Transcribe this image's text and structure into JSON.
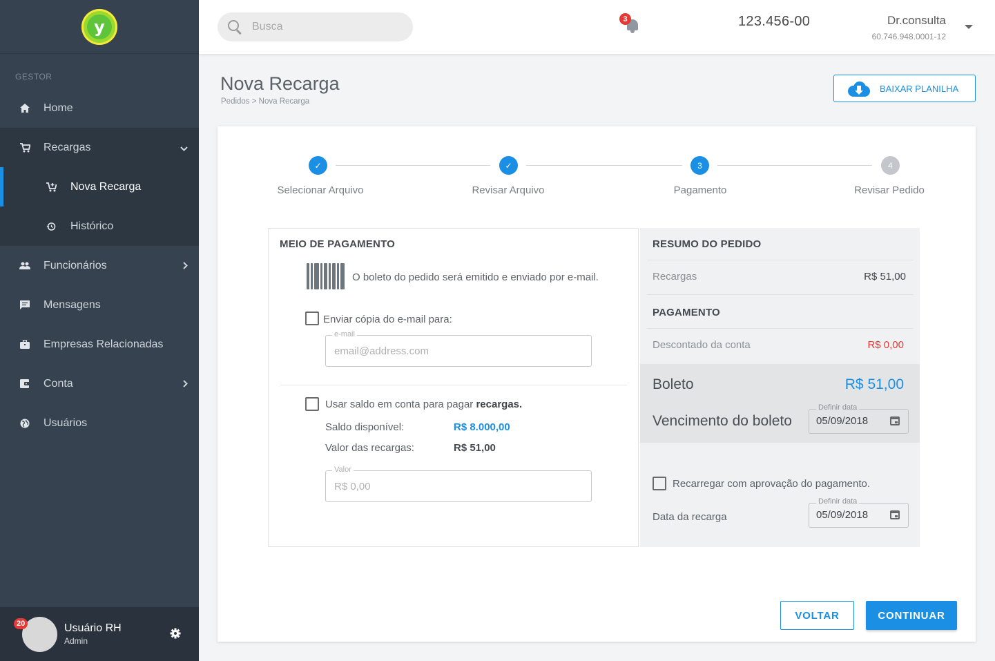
{
  "sidebar": {
    "logo_letter": "y",
    "section_label": "GESTOR",
    "items": [
      {
        "label": "Home",
        "icon": "home-icon"
      },
      {
        "label": "Recargas",
        "icon": "cart-icon"
      },
      {
        "label": "Nova Recarga",
        "icon": "cart-add-icon"
      },
      {
        "label": "Histórico",
        "icon": "history-icon"
      },
      {
        "label": "Funcionários",
        "icon": "people-icon"
      },
      {
        "label": "Mensagens",
        "icon": "message-icon"
      },
      {
        "label": "Empresas Relacionadas",
        "icon": "briefcase-icon"
      },
      {
        "label": "Conta",
        "icon": "wallet-icon"
      },
      {
        "label": "Usuários",
        "icon": "globe-icon"
      }
    ],
    "user": {
      "name": "Usuário RH",
      "role": "Admin",
      "badge": "20"
    }
  },
  "topbar": {
    "search_placeholder": "Busca",
    "notification_count": "3",
    "account_number": "123.456-00",
    "company_name": "Dr.consulta",
    "company_cnpj": "60.746.948.0001-12"
  },
  "page": {
    "title": "Nova Recarga",
    "breadcrumb": "Pedidos > Nova Recarga",
    "download_button": "BAIXAR PLANILHA"
  },
  "stepper": {
    "steps": [
      {
        "label": "Selecionar Arquivo",
        "marker": "✓",
        "state": "done"
      },
      {
        "label": "Revisar Arquivo",
        "marker": "✓",
        "state": "done"
      },
      {
        "label": "Pagamento",
        "marker": "3",
        "state": "current"
      },
      {
        "label": "Revisar Pedido",
        "marker": "4",
        "state": "todo"
      }
    ]
  },
  "payment": {
    "title": "MEIO DE PAGAMENTO",
    "boleto_info": "O boleto do pedido será emitido e enviado por e-mail.",
    "email_copy_label": "Enviar cópia do e-mail para:",
    "email_field_label": "e-mail",
    "email_placeholder": "email@address.com",
    "use_balance_label": "Usar saldo em conta para pagar ",
    "use_balance_bold": "recargas.",
    "available_balance_label": "Saldo disponível:",
    "available_balance_value": "R$ 8.000,00",
    "recharge_value_label": "Valor das recargas:",
    "recharge_value_value": "R$ 51,00",
    "value_field_label": "Valor",
    "value_placeholder": "R$ 0,00"
  },
  "summary": {
    "title": "RESUMO DO PEDIDO",
    "recargas_label": "Recargas",
    "recargas_value": "R$ 51,00",
    "payment_title": "PAGAMENTO",
    "discount_label": "Descontado da conta",
    "discount_value": "R$ 0,00",
    "boleto_label": "Boleto",
    "boleto_value": "R$ 51,00",
    "due_label": "Vencimento do boleto",
    "due_field_label": "Definir data",
    "due_date": "05/09/2018",
    "approval_label": "Recarregar com aprovação do pagamento.",
    "recharge_date_label": "Data da recarga",
    "recharge_date_field_label": "Definir data",
    "recharge_date": "05/09/2018"
  },
  "actions": {
    "back": "VOLTAR",
    "continue": "CONTINUAR"
  },
  "colors": {
    "accent": "#1a8fe3",
    "sidebar_bg": "#36424f",
    "negative": "#e53935"
  }
}
